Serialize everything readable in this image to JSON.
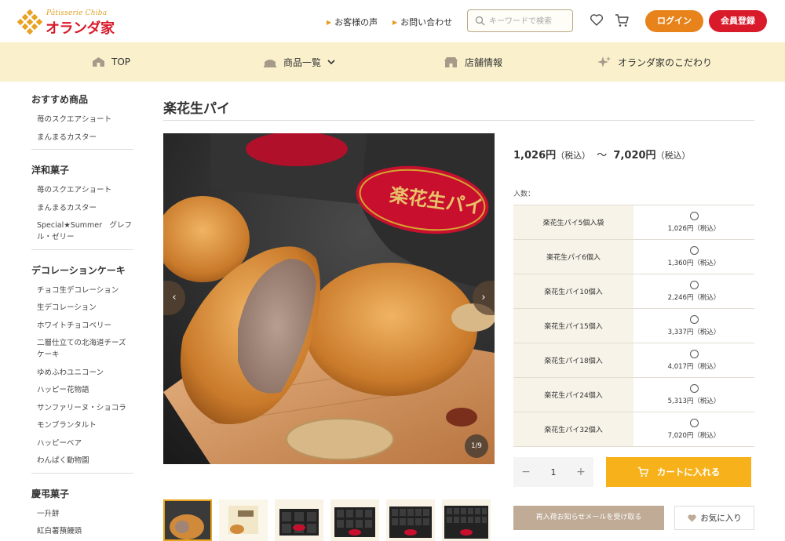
{
  "brand": {
    "subtitle": "Pâtisserie Chiba",
    "name": "オランダ家",
    "color_primary": "#d9192a",
    "color_accent": "#e8831c"
  },
  "header": {
    "links": [
      {
        "label": "お客様の声"
      },
      {
        "label": "お問い合わせ"
      }
    ],
    "search_placeholder": "キーワードで検索",
    "login_label": "ログイン",
    "register_label": "会員登録",
    "icons": [
      "search-icon",
      "heart-icon",
      "cart-icon"
    ]
  },
  "nav": {
    "items": [
      {
        "label": "TOP",
        "icon": "home-icon"
      },
      {
        "label": "商品一覧",
        "icon": "cake-icon"
      },
      {
        "label": "店舗情報",
        "icon": "store-icon"
      },
      {
        "label": "オランダ家のこだわり",
        "icon": "sparkle-icon"
      }
    ]
  },
  "sidebar": {
    "sections": [
      {
        "heading": "おすすめ商品",
        "items": [
          "苺のスクエアショート",
          "まんまるカスター"
        ]
      },
      {
        "heading": "洋和菓子",
        "items": [
          "苺のスクエアショート",
          "まんまるカスター",
          "Special★Summer　グレフル・ゼリー"
        ]
      },
      {
        "heading": "デコレーションケーキ",
        "items": [
          "チョコ生デコレーション",
          "生デコレーション",
          "ホワイトチョコベリー",
          "二層仕立ての北海道チーズケーキ",
          "ゆめふわユニコーン",
          "ハッピー花物語",
          "サンファリーヌ・ショコラ",
          "モンブランタルト",
          "ハッピーベア",
          "わんぱく動物園"
        ]
      },
      {
        "heading": "慶弔菓子",
        "items": [
          "一升餅",
          "紅白薯蕷饅頭"
        ]
      }
    ]
  },
  "product": {
    "title": "楽花生パイ",
    "price_min": "1,026円",
    "price_max": "7,020円",
    "tax_note": "（税込）",
    "range_sep": "〜",
    "qty_label": "入数：",
    "gallery_counter": "1/9",
    "gallery_package_text": "楽花生パイ",
    "options": [
      {
        "name": "楽花生パイ5個入袋",
        "price": "1,026円（税込）"
      },
      {
        "name": "楽花生パイ6個入",
        "price": "1,360円（税込）"
      },
      {
        "name": "楽花生パイ10個入",
        "price": "2,246円（税込）"
      },
      {
        "name": "楽花生パイ15個入",
        "price": "3,337円（税込）"
      },
      {
        "name": "楽花生パイ18個入",
        "price": "4,017円（税込）"
      },
      {
        "name": "楽花生パイ24個入",
        "price": "5,313円（税込）"
      },
      {
        "name": "楽花生パイ32個入",
        "price": "7,020円（税込）"
      }
    ],
    "quantity": "1",
    "minus": "−",
    "plus": "+",
    "cart_label": "カートに入れる",
    "notify_label": "再入荷お知らせメールを受け取る",
    "fav_label": "お気に入り"
  }
}
